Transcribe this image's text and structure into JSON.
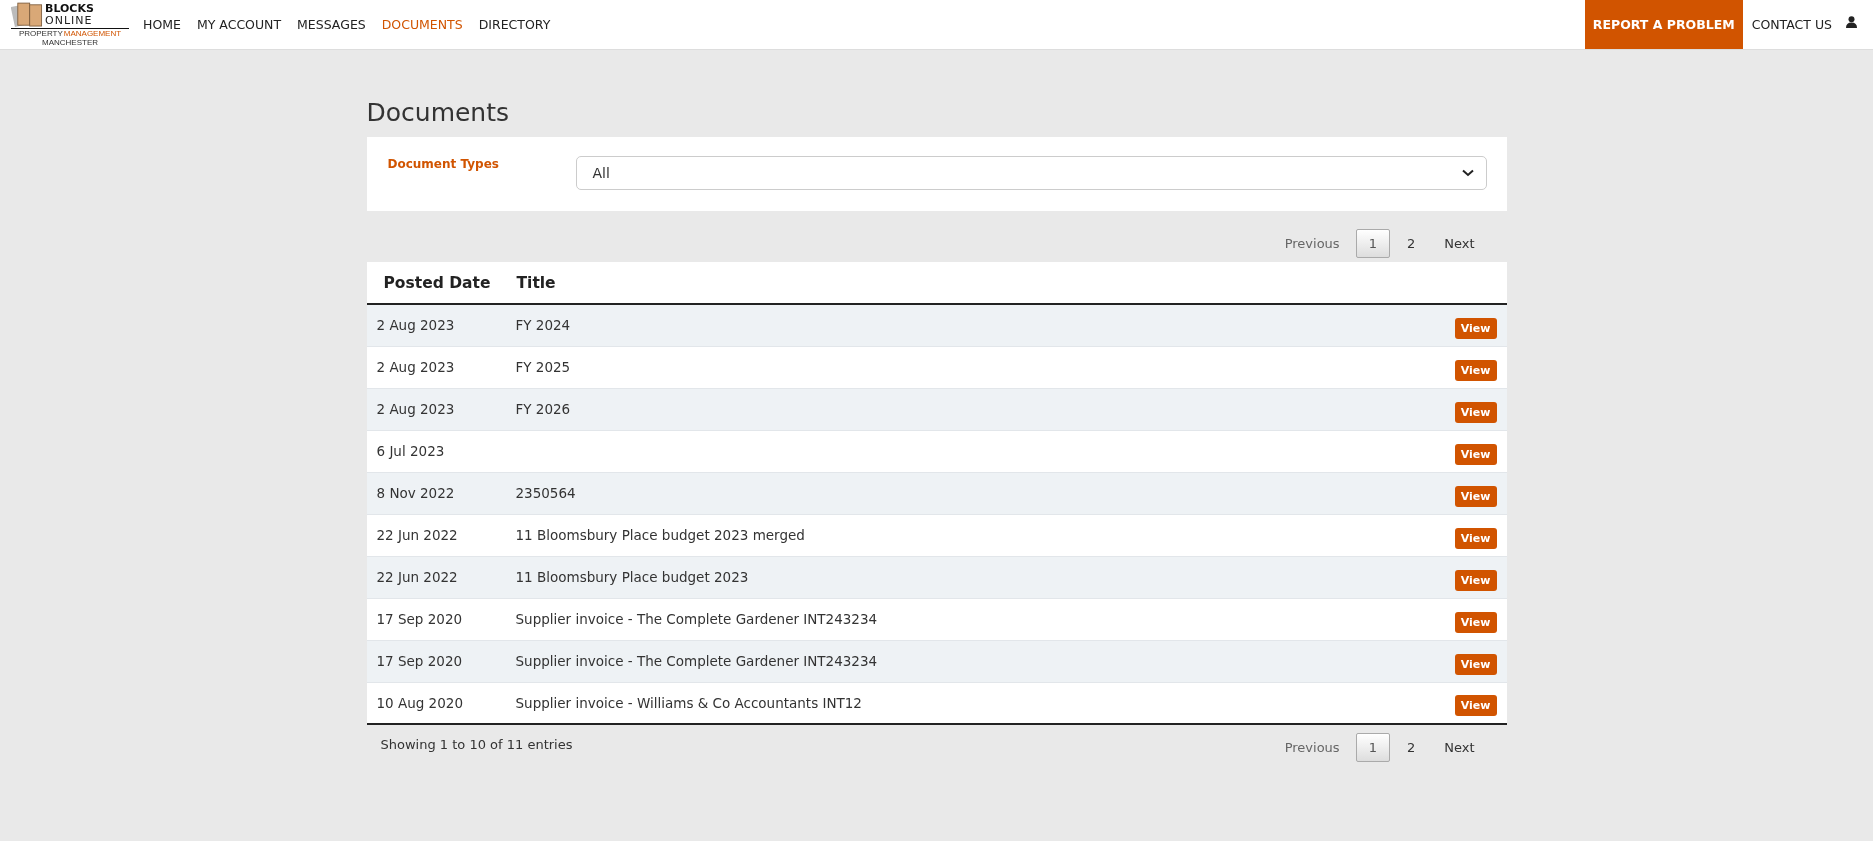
{
  "logo": {
    "line_1": "BLOCKS",
    "line_2": "ONLINE",
    "tagline_1": "PROPERTY",
    "tagline_2": "MANAGEMENT",
    "tagline_3": "MANCHESTER"
  },
  "nav": [
    {
      "label": "HOME",
      "selected": false
    },
    {
      "label": "MY ACCOUNT",
      "selected": false
    },
    {
      "label": "MESSAGES",
      "selected": false
    },
    {
      "label": "DOCUMENTS",
      "selected": true
    },
    {
      "label": "DIRECTORY",
      "selected": false
    }
  ],
  "report_button": "REPORT A PROBLEM",
  "contact_link": "CONTACT US",
  "page_title": "Documents",
  "filter": {
    "label": "Document Types",
    "value": "All"
  },
  "pagination_top": {
    "previous": "Previous",
    "next": "Next",
    "pages": [
      {
        "label": "1",
        "selected": true
      },
      {
        "label": "2",
        "selected": false
      }
    ]
  },
  "table": {
    "columns": [
      "Posted Date",
      "Title"
    ],
    "rows": [
      {
        "date": "2 Aug 2023",
        "title": "FY 2024",
        "action": "View"
      },
      {
        "date": "2 Aug 2023",
        "title": "FY 2025",
        "action": "View"
      },
      {
        "date": "2 Aug 2023",
        "title": "FY 2026",
        "action": "View"
      },
      {
        "date": "6 Jul 2023",
        "action": "View"
      },
      {
        "date": "8 Nov 2022",
        "title": "2350564",
        "action": "View"
      },
      {
        "date": "22 Jun 2022",
        "title": "11 Bloomsbury Place budget 2023 merged",
        "action": "View"
      },
      {
        "date": "22 Jun 2022",
        "title": "11 Bloomsbury Place budget 2023",
        "action": "View"
      },
      {
        "date": "17 Sep 2020",
        "title": "Supplier invoice - The Complete Gardener INT243234",
        "action": "View"
      },
      {
        "date": "17 Sep 2020",
        "title": "Supplier invoice - The Complete Gardener INT243234",
        "action": "View"
      },
      {
        "date": "10 Aug 2020",
        "title": "Supplier invoice - Williams & Co Accountants INT12",
        "action": "View"
      }
    ]
  },
  "entries_info": "Showing 1 to 10 of 11 entries",
  "pagination_bottom": {
    "previous": "Previous",
    "next": "Next",
    "pages": [
      {
        "label": "1",
        "selected": true
      },
      {
        "label": "2",
        "selected": false
      }
    ]
  }
}
